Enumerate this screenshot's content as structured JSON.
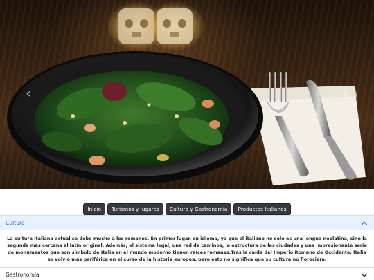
{
  "carousel": {
    "prev_icon": "chevron-left-icon",
    "next_icon": "chevron-right-icon",
    "prev_symbol": "‹",
    "next_symbol": "›"
  },
  "nav": {
    "items": [
      {
        "label": "Inicio"
      },
      {
        "label": "Turismos y lugares"
      },
      {
        "label": "Cultura y Gastronomía"
      },
      {
        "label": "Productos Italianos"
      }
    ]
  },
  "accordion": {
    "sections": [
      {
        "title": "Cultura",
        "expanded": true,
        "body": "La cultura italiana actual se debe mucho a los romanos. En primer lugar, su idioma, ya que el italiano no solo es una lengua neolatina, sino la segunda más cercana al latín original. Además, el sistema legal, una red de caminos, la estructura de las ciudades y una impresionante serie de monumentos que son símbolo de Italia en el mundo moderno tienen raíces romanas.Tras la caída del Imperio Romano de Occidente, Italia se volvió más periférica en el curso de la historia europea, pero esto no significa que su cultura no floreciera."
      },
      {
        "title": "Gastronomía",
        "expanded": false
      }
    ]
  },
  "colors": {
    "accordion_open_bg": "#e7f1ff",
    "accordion_open_text": "#0c63e4",
    "nav_button_bg": "#343a40"
  }
}
